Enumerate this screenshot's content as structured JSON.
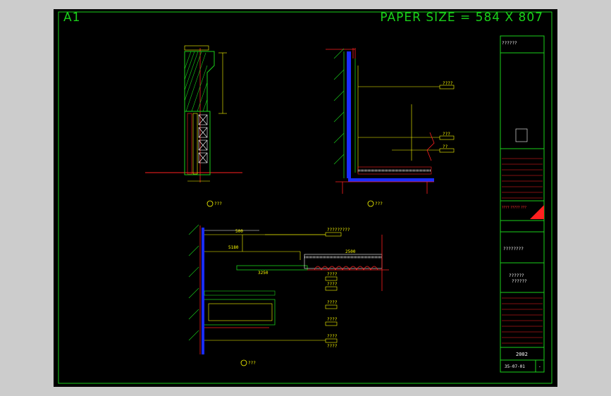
{
  "header": {
    "sheet_label": "A1",
    "paper_size": "PAPER SIZE = 584 X 807"
  },
  "drawing": {
    "detail_a_title": "???",
    "detail_b_title": "???",
    "detail_c_title": "???",
    "detail_b_callouts": [
      "????",
      "???",
      "??"
    ],
    "detail_c_callouts": [
      "?????????",
      "????",
      "????",
      "????",
      "????",
      "????",
      "????"
    ],
    "dimensions": [
      "500",
      "5180",
      "3250",
      "2500"
    ]
  },
  "title_block": {
    "project_name": "??????",
    "company_name": "???? ????? ???",
    "drawing_title": "????????",
    "drawing_name_1": "??????",
    "drawing_name_2": "??????",
    "sheet_number": "2002",
    "date": "35-07-01",
    "revision": "-"
  },
  "colors": {
    "background": "#000000",
    "frame": "#1ad01a",
    "annotation": "#ffff00",
    "section_line": "#ff2020",
    "wall_fill": "#3040ff"
  }
}
